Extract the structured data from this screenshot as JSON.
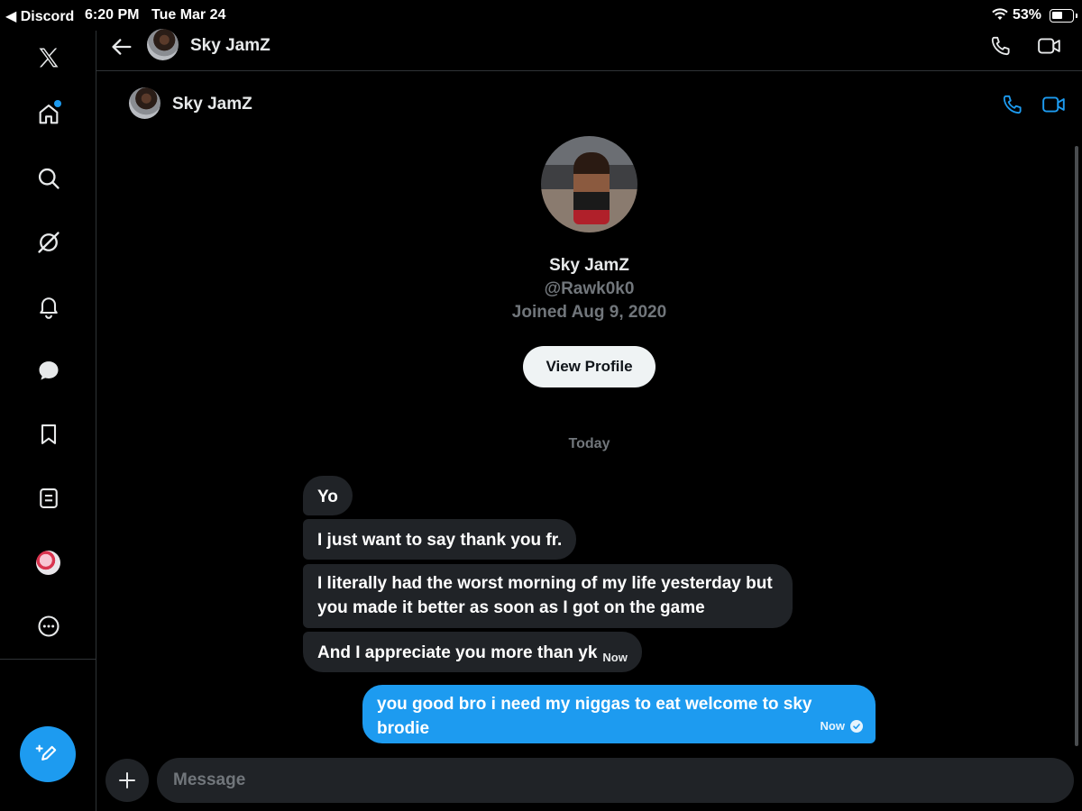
{
  "status_bar": {
    "back_app": "◀ Discord",
    "time": "6:20 PM",
    "date": "Tue Mar 24",
    "battery_percent": "53%",
    "battery_level": 0.53
  },
  "sidebar": {
    "items": [
      {
        "name": "x-logo-icon"
      },
      {
        "name": "home-icon",
        "notification_dot": true
      },
      {
        "name": "search-icon"
      },
      {
        "name": "grok-icon"
      },
      {
        "name": "notifications-icon"
      },
      {
        "name": "messages-icon"
      },
      {
        "name": "bookmarks-icon"
      },
      {
        "name": "lists-icon"
      },
      {
        "name": "profile-avatar-icon"
      },
      {
        "name": "more-icon"
      }
    ],
    "compose_icon": "compose-icon"
  },
  "header": {
    "title": "Sky JamZ"
  },
  "conversation": {
    "name": "Sky JamZ"
  },
  "profile": {
    "name": "Sky JamZ",
    "handle": "@Rawk0k0",
    "joined": "Joined Aug 9, 2020",
    "view_profile_label": "View Profile"
  },
  "day_separator": "Today",
  "messages": [
    {
      "from": "them",
      "text": "Yo"
    },
    {
      "from": "them",
      "text": "I just want to say thank you fr."
    },
    {
      "from": "them",
      "text": "I literally had the worst morning of my life yesterday but you made it better as soon as I got on the game"
    },
    {
      "from": "them",
      "text": "And I appreciate you more than yk",
      "time": "Now"
    },
    {
      "from": "me",
      "text": "you good bro i need my niggas to eat welcome to sky brodie",
      "time": "Now"
    }
  ],
  "composer": {
    "placeholder": "Message"
  },
  "colors": {
    "accent": "#1d9bf0",
    "bubble_incoming": "#202327",
    "background": "#000000"
  }
}
